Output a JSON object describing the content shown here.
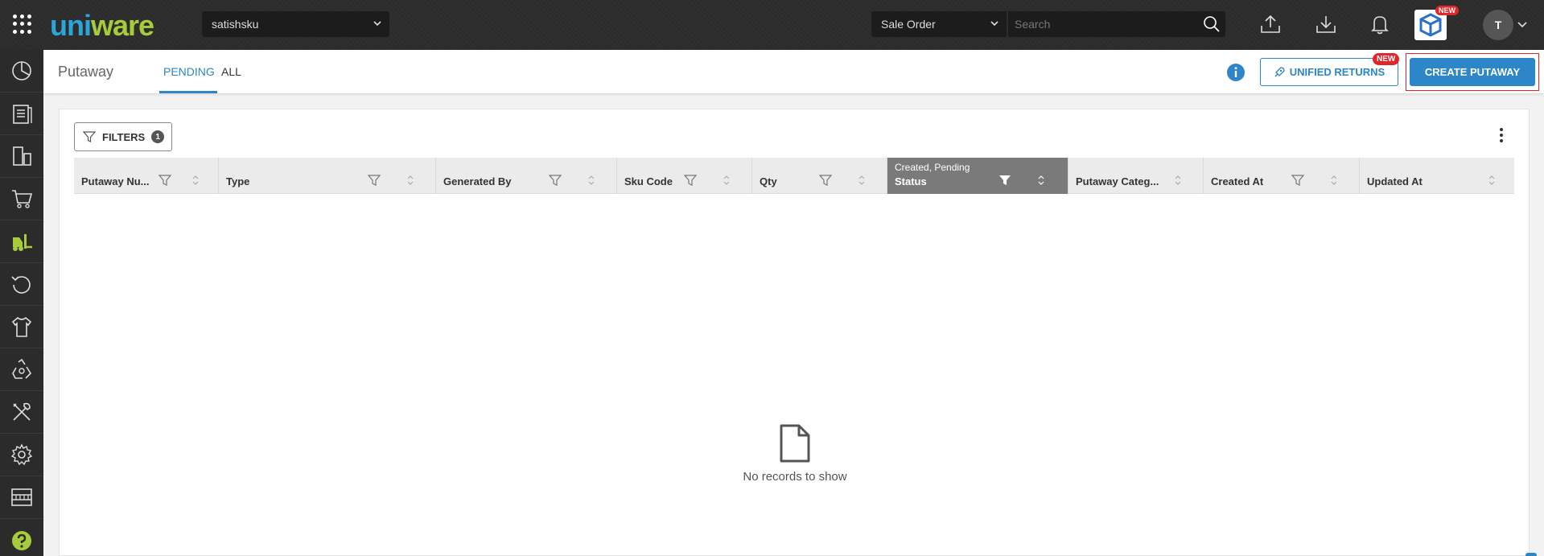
{
  "topbar": {
    "logo_part1": "uni",
    "logo_part2": "ware",
    "tenant": "satishsku",
    "search_type": "Sale Order",
    "search_placeholder": "Search",
    "app_new_tag": "NEW",
    "avatar_initial": "T"
  },
  "sidebar": {
    "items": [
      "dashboard",
      "orders",
      "products",
      "cart",
      "putaway",
      "returns",
      "apparel",
      "recycle",
      "tools",
      "settings",
      "warehouse",
      "help"
    ],
    "active_color": "#a6cc3c"
  },
  "header": {
    "title": "Putaway",
    "tabs": [
      {
        "label": "PENDING",
        "active": true
      },
      {
        "label": "ALL",
        "active": false
      }
    ],
    "unified_returns_label": "UNIFIED RETURNS",
    "unified_returns_tag": "NEW",
    "create_label": "CREATE PUTAWAY"
  },
  "table": {
    "filters_label": "FILTERS",
    "filter_count": "1",
    "columns": [
      {
        "label": "Putaway Nu...",
        "filter": true,
        "active": false
      },
      {
        "label": "Type",
        "filter": true,
        "active": false
      },
      {
        "label": "Generated By",
        "filter": true,
        "active": false
      },
      {
        "label": "Sku Code",
        "filter": true,
        "active": false
      },
      {
        "label": "Qty",
        "filter": true,
        "active": false
      },
      {
        "label": "Status",
        "filter": true,
        "active": true,
        "sub": "Created, Pending"
      },
      {
        "label": "Putaway Categ...",
        "filter": false,
        "active": false
      },
      {
        "label": "Created At",
        "filter": true,
        "active": false
      },
      {
        "label": "Updated At",
        "filter": false,
        "active": false
      }
    ],
    "empty_text": "No records to show"
  },
  "colors": {
    "primary": "#2c86c7",
    "danger": "#e0262b",
    "topbar": "#2b2b2b"
  }
}
